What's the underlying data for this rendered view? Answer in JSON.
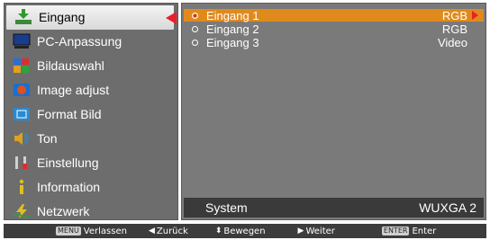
{
  "sidebar": {
    "items": [
      {
        "label": "Eingang",
        "icon": "input-icon"
      },
      {
        "label": "PC-Anpassung",
        "icon": "pc-adjust-icon"
      },
      {
        "label": "Bildauswahl",
        "icon": "image-select-icon"
      },
      {
        "label": "Image adjust",
        "icon": "image-adjust-icon"
      },
      {
        "label": "Format Bild",
        "icon": "screen-format-icon"
      },
      {
        "label": "Ton",
        "icon": "sound-icon"
      },
      {
        "label": "Einstellung",
        "icon": "setting-icon"
      },
      {
        "label": "Information",
        "icon": "information-icon"
      },
      {
        "label": "Netzwerk",
        "icon": "network-icon"
      }
    ],
    "selected_index": 0
  },
  "main": {
    "rows": [
      {
        "name": "Eingang 1",
        "value": "RGB"
      },
      {
        "name": "Eingang 2",
        "value": "RGB"
      },
      {
        "name": "Eingang 3",
        "value": "Video"
      }
    ],
    "selected_index": 0,
    "system": {
      "label": "System",
      "value": "WUXGA 2"
    }
  },
  "hints": {
    "menu_key": "MENU",
    "menu_label": "Verlassen",
    "back_label": "Zurück",
    "move_label": "Bewegen",
    "next_label": "Weiter",
    "enter_key": "ENTER",
    "enter_label": "Enter"
  },
  "colors": {
    "accent_orange": "#e08a1c",
    "arrow_red": "#e8202a",
    "panel_gray": "#7a7a7a",
    "sidebar_gray": "#6d6d6d"
  }
}
